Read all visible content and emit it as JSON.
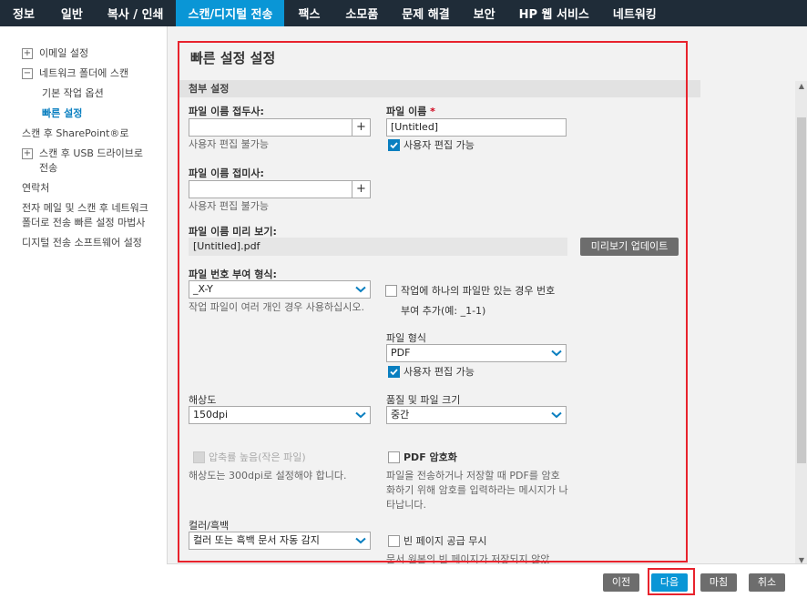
{
  "nav": {
    "tabs": [
      "정보",
      "일반",
      "복사 / 인쇄",
      "스캔/디지털 전송",
      "팩스",
      "소모품",
      "문제 해결",
      "보안",
      "HP 웹 서비스",
      "네트워킹"
    ],
    "active_index": 3
  },
  "sidebar": {
    "items": [
      {
        "label": "이메일 설정",
        "expander": "+"
      },
      {
        "label": "네트워크 폴더에 스캔",
        "expander": "−"
      },
      {
        "label": "기본 작업 옵션"
      },
      {
        "label": "빠른 설정",
        "active": true
      },
      {
        "label": "스캔 후 SharePoint®로"
      },
      {
        "label": "스캔 후 USB 드라이브로 전송",
        "expander": "+"
      },
      {
        "label": "연락처"
      },
      {
        "label": "전자 메일 및 스캔 후 네트워크 폴더로 전송 빠른 설정 마법사"
      },
      {
        "label": "디지털 전송 소프트웨어 설정"
      }
    ]
  },
  "main": {
    "title": "빠른 설정 설정",
    "section": "첨부 설정",
    "prefix": {
      "label": "파일 이름 접두사:",
      "value": "",
      "hint": "사용자 편집 불가능",
      "add": "+"
    },
    "file_name": {
      "label": "파일 이름",
      "required": "*",
      "value": "[Untitled]",
      "checkbox": "사용자 편집 가능"
    },
    "suffix": {
      "label": "파일 이름 접미사:",
      "value": "",
      "hint": "사용자 편집 불가능",
      "add": "+"
    },
    "preview": {
      "label": "파일 이름 미리 보기:",
      "value": "[Untitled].pdf",
      "button": "미리보기 업데이트"
    },
    "numbering": {
      "label": "파일 번호 부여 형식:",
      "value": "_X-Y",
      "hint": "작업 파일이 여러 개인 경우 사용하십시오.",
      "checkbox_line1": "작업에 하나의 파일만 있는 경우 번호",
      "checkbox_line2": "부여 추가(예: _1-1)"
    },
    "file_type": {
      "label": "파일 형식",
      "value": "PDF",
      "checkbox": "사용자 편집 가능"
    },
    "resolution": {
      "label": "해상도",
      "value": "150dpi"
    },
    "quality": {
      "label": "품질 및 파일 크기",
      "value": "중간"
    },
    "compression": {
      "checkbox": "압축률 높음(작은 파일)",
      "hint": "해상도는 300dpi로 설정해야 합니다."
    },
    "encryption": {
      "checkbox": "PDF 암호화",
      "hint": "파일을 전송하거나 저장할 때 PDF를 암호화하기 위해 암호를 입력하라는 메시지가 나타납니다."
    },
    "color": {
      "label": "컬러/흑백",
      "value": "컬러 또는 흑백 문서 자동 감지"
    },
    "blank_page": {
      "checkbox": "빈 페이지 공급 무시",
      "hint": "문서 원본의 빈 페이지가 저장되지 않았"
    }
  },
  "footer": {
    "prev": "이전",
    "next": "다음",
    "finish": "마침",
    "cancel": "취소"
  },
  "colors": {
    "nav_bg": "#1f2c38",
    "accent": "#0a96d6",
    "highlight": "#e8232d"
  }
}
